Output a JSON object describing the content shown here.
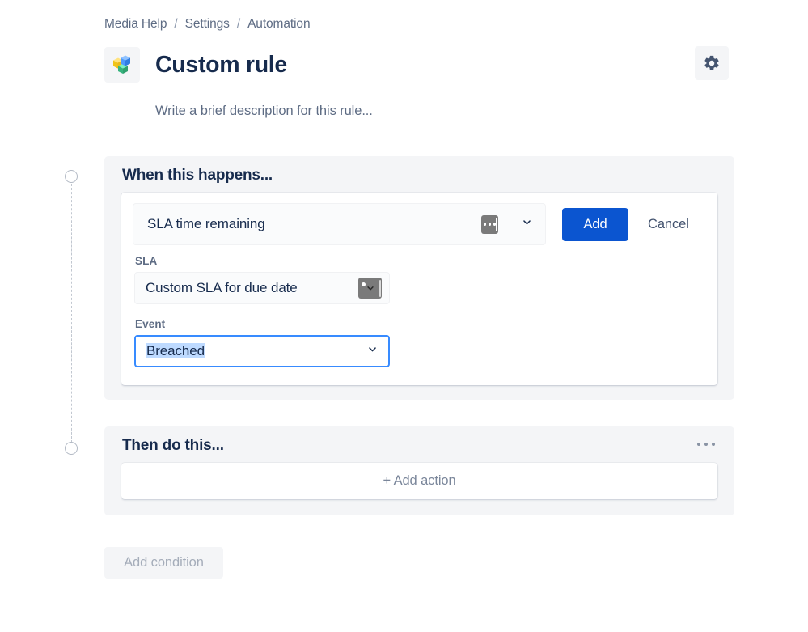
{
  "breadcrumb": {
    "items": [
      "Media Help",
      "Settings",
      "Automation"
    ],
    "separator": "/"
  },
  "header": {
    "title": "Custom rule",
    "avatar_icon": "cubes-icon",
    "settings_icon": "gear-icon",
    "description": "Write a brief description for this rule..."
  },
  "trigger_card": {
    "heading": "When this happens...",
    "selector": {
      "label": "SLA time remaining",
      "image_icon": "broken-image-icon",
      "chevron_icon": "chevron-down-icon"
    },
    "add_label": "Add",
    "cancel_label": "Cancel",
    "fields": [
      {
        "label": "SLA",
        "value": "Custom SLA for due date",
        "icon": "broken-image-chevron-icon",
        "focused": false
      },
      {
        "label": "Event",
        "value": "Breached",
        "icon": "chevron-down-icon",
        "focused": true
      }
    ]
  },
  "action_card": {
    "heading": "Then do this...",
    "menu_icon": "more-options-icon",
    "add_action_label": "+ Add action"
  },
  "footer": {
    "add_condition_label": "Add condition"
  },
  "colors": {
    "accent_blue": "#0b55d0",
    "focus_blue": "#388bff",
    "selection_blue": "#bedaff",
    "card_bg": "#f4f5f7",
    "text_primary": "#172b4d",
    "text_subtle": "#5e6c84",
    "text_disabled": "#a5adba"
  }
}
